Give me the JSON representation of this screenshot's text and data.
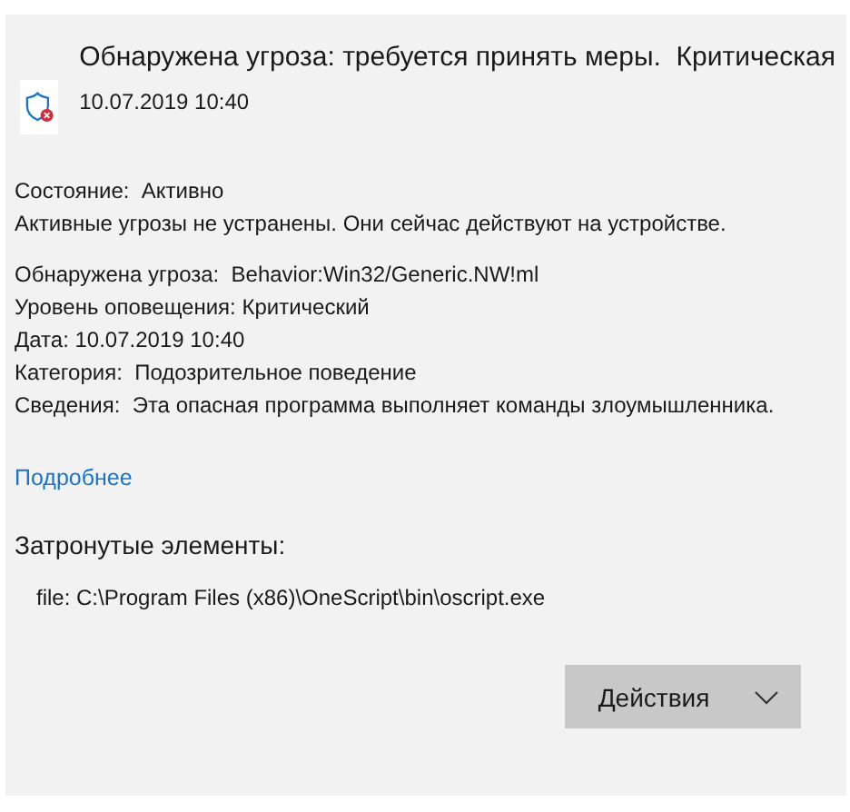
{
  "header": {
    "title": "Обнаружена угроза: требуется принять меры.  Критическая",
    "date": "10.07.2019 10:40"
  },
  "status": [
    "Состояние:  Активно",
    "Активные угрозы не устранены. Они сейчас действуют на устройстве."
  ],
  "details": [
    "Обнаружена угроза:  Behavior:Win32/Generic.NW!ml",
    "Уровень оповещения: Критический",
    "Дата: 10.07.2019 10:40",
    "Категория:  Подозрительное поведение",
    "Сведения:  Эта опасная программа выполняет команды злоумышленника."
  ],
  "more_link": "Подробнее",
  "affected": {
    "heading": "Затронутые элементы:",
    "items": [
      "file: C:\\Program Files (x86)\\OneScript\\bin\\oscript.exe"
    ]
  },
  "actions_button": "Действия"
}
